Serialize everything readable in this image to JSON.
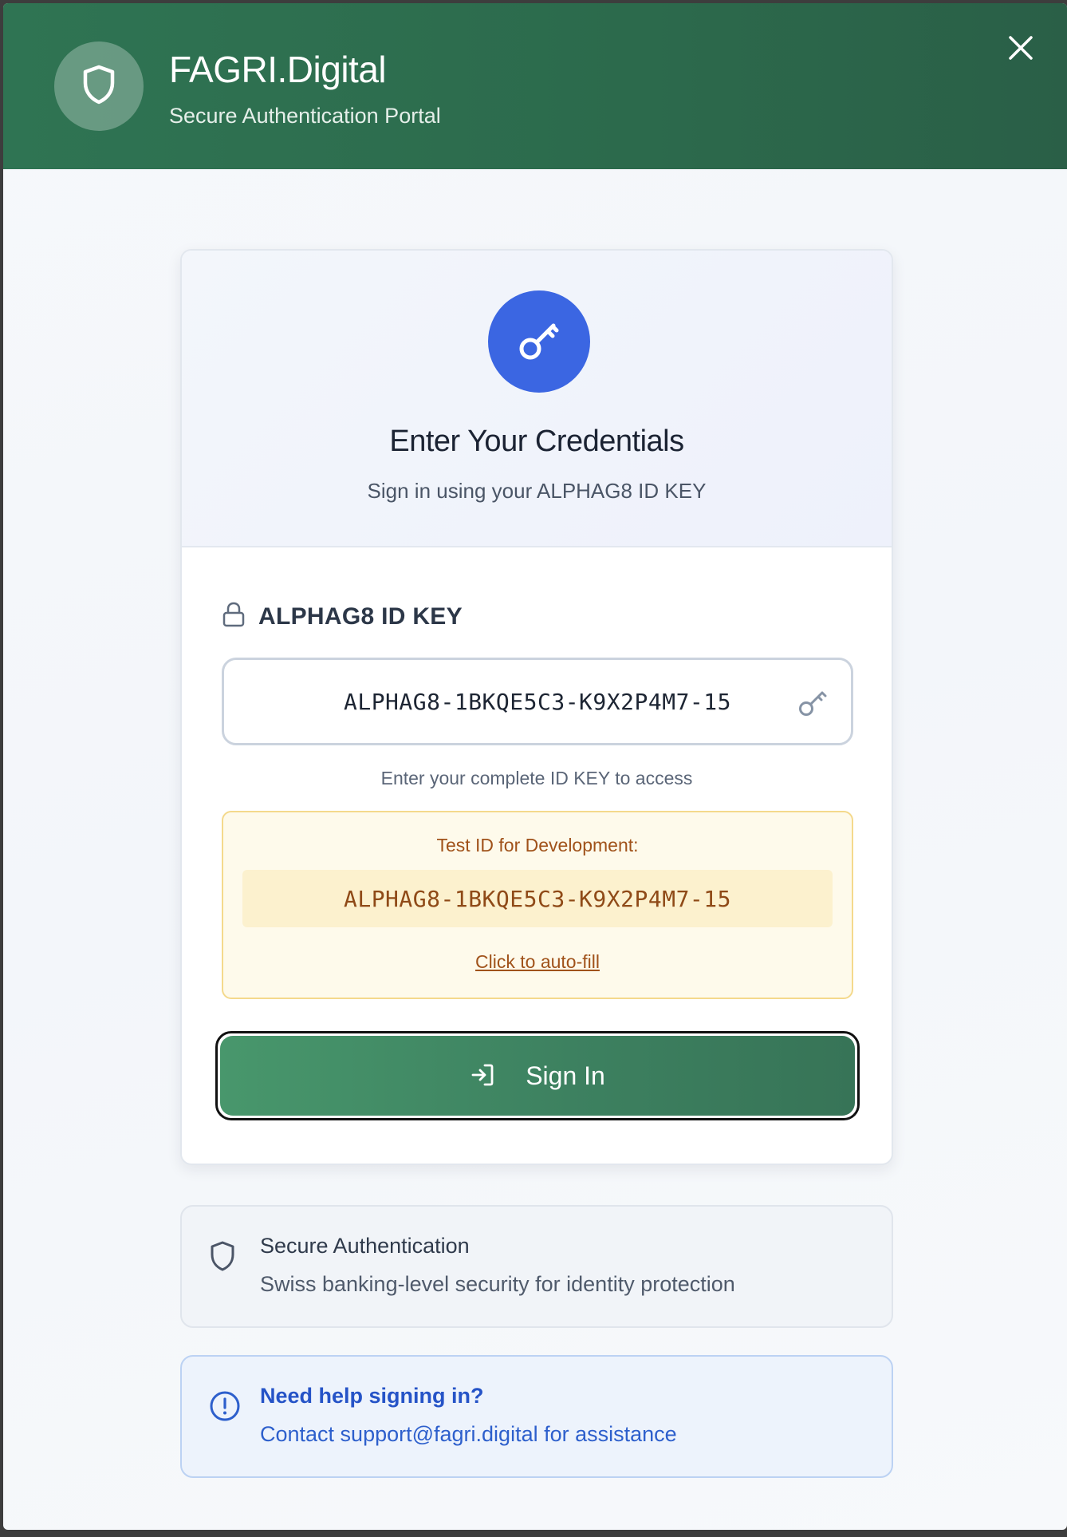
{
  "header": {
    "title": "FAGRI.Digital",
    "subtitle": "Secure Authentication Portal"
  },
  "card": {
    "title": "Enter Your Credentials",
    "subtitle": "Sign in using your ALPHAG8 ID KEY",
    "field_label": "ALPHAG8 ID KEY",
    "id_value": "ALPHAG8-1BKQE5C3-K9X2P4M7-15",
    "helper": "Enter your complete ID KEY to access",
    "test": {
      "label": "Test ID for Development:",
      "code": "ALPHAG8-1BKQE5C3-K9X2P4M7-15",
      "autofill": "Click to auto-fill"
    },
    "signin_label": "Sign In"
  },
  "secure_info": {
    "title": "Secure Authentication",
    "text": "Swiss banking-level security for identity protection"
  },
  "help_info": {
    "title": "Need help signing in?",
    "text": "Contact support@fagri.digital for assistance"
  },
  "colors": {
    "header_green": "#2f7453",
    "accent_blue": "#3b66e2",
    "button_green": "#48976c",
    "test_brown": "#a0521a"
  },
  "icons": [
    "shield-icon",
    "close-icon",
    "key-icon",
    "lock-icon",
    "sign-in-icon",
    "info-icon"
  ]
}
